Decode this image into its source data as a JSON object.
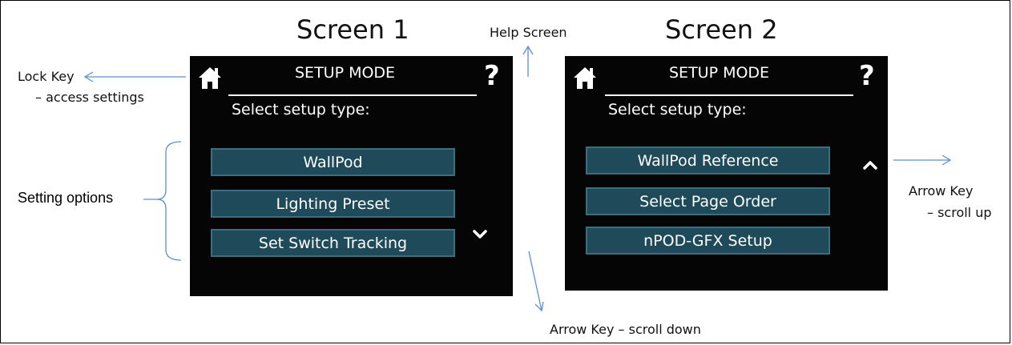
{
  "screen1": {
    "heading": "Screen 1",
    "device_title": "SETUP MODE",
    "prompt": "Select setup type:",
    "options": [
      "WallPod",
      "Lighting Preset",
      "Set Switch Tracking"
    ],
    "home_icon": "home-icon",
    "help_icon": "?",
    "scroll_icon": "chevron-down-icon"
  },
  "screen2": {
    "heading": "Screen 2",
    "device_title": "SETUP MODE",
    "prompt": "Select setup type:",
    "options": [
      "WallPod Reference",
      "Select Page Order",
      "nPOD-GFX Setup"
    ],
    "home_icon": "home-icon",
    "help_icon": "?",
    "scroll_icon": "chevron-up-icon"
  },
  "annotations": {
    "help_screen": "Help Screen",
    "lock_key": "Lock Key",
    "lock_key_desc": "– access settings",
    "setting_options": "Setting options",
    "arrow_key_down": "Arrow Key – scroll down",
    "arrow_key_up": "Arrow Key",
    "arrow_key_up_desc": "– scroll up"
  },
  "colors": {
    "device_bg": "#050505",
    "option_bg": "#1f4a5a",
    "option_border": "#3b6f80",
    "annotation_line": "#5b8fd0"
  }
}
